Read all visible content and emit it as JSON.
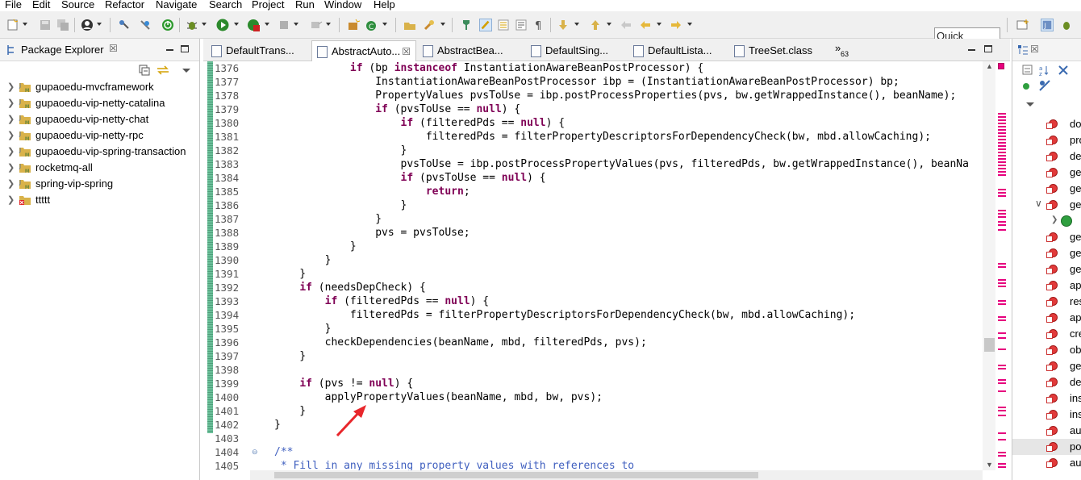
{
  "menu": [
    "File",
    "Edit",
    "Source",
    "Refactor",
    "Navigate",
    "Search",
    "Project",
    "Run",
    "Window",
    "Help"
  ],
  "toolbar": {
    "quick_access_label": "Quick Access"
  },
  "package_explorer": {
    "title": "Package Explorer",
    "close_glyph": "☒",
    "projects": [
      "gupaoedu-mvcframework",
      "gupaoedu-vip-netty-catalina",
      "gupaoedu-vip-netty-chat",
      "gupaoedu-vip-netty-rpc",
      "gupaoedu-vip-spring-transaction",
      "rocketmq-all",
      "spring-vip-spring",
      "ttttt"
    ]
  },
  "editor": {
    "tabs": [
      {
        "label": "DefaultTrans...",
        "active": false
      },
      {
        "label": "AbstractAuto...",
        "active": true,
        "close": "☒"
      },
      {
        "label": "AbstractBea...",
        "active": false
      },
      {
        "label": "DefaultSing...",
        "active": false
      },
      {
        "label": "DefaultLista...",
        "active": false
      },
      {
        "label": "TreeSet.class",
        "active": false
      }
    ],
    "more_tabs": "»",
    "more_tabs_count": "63",
    "line_numbers": [
      "1376",
      "1377",
      "1378",
      "1379",
      "1380",
      "1381",
      "1382",
      "1383",
      "1384",
      "1385",
      "1386",
      "1387",
      "1388",
      "1389",
      "1390",
      "1391",
      "1392",
      "1393",
      "1394",
      "1395",
      "1396",
      "1397",
      "1398",
      "1399",
      "1400",
      "1401",
      "1402",
      "1403",
      "1404",
      "1405"
    ],
    "code_lines": [
      "            if (bp instanceof InstantiationAwareBeanPostProcessor) {",
      "                InstantiationAwareBeanPostProcessor ibp = (InstantiationAwareBeanPostProcessor) bp;",
      "                PropertyValues pvsToUse = ibp.postProcessProperties(pvs, bw.getWrappedInstance(), beanName);",
      "                if (pvsToUse == null) {",
      "                    if (filteredPds == null) {",
      "                        filteredPds = filterPropertyDescriptorsForDependencyCheck(bw, mbd.allowCaching);",
      "                    }",
      "                    pvsToUse = ibp.postProcessPropertyValues(pvs, filteredPds, bw.getWrappedInstance(), beanNa",
      "                    if (pvsToUse == null) {",
      "                        return;",
      "                    }",
      "                }",
      "                pvs = pvsToUse;",
      "            }",
      "        }",
      "    }",
      "    if (needsDepCheck) {",
      "        if (filteredPds == null) {",
      "            filteredPds = filterPropertyDescriptorsForDependencyCheck(bw, mbd.allowCaching);",
      "        }",
      "        checkDependencies(beanName, mbd, filteredPds, pvs);",
      "    }",
      "",
      "    if (pvs != null) {",
      "        applyPropertyValues(beanName, mbd, bw, pvs);",
      "    }",
      "}",
      "",
      "/**",
      " * Fill in any missing property values with references to"
    ],
    "fold_marker": "⊖",
    "scroll_up": "▲",
    "scroll_down": "▼"
  },
  "outline": {
    "title_glyph": "☒",
    "members": [
      "do",
      "pro",
      "de",
      "ge",
      "ge",
      "ge",
      "",
      "ge",
      "ge",
      "ge",
      "ap",
      "res",
      "ap",
      "cre",
      "ob",
      "ge",
      "de",
      "ins",
      "ins",
      "au",
      "po",
      "au"
    ],
    "selected_index": 20
  },
  "colors": {
    "keyword": "#7f0055",
    "comment": "#3f5fbf",
    "annotation_arrow": "#e8262b",
    "change_bar": "#6bc19a"
  }
}
